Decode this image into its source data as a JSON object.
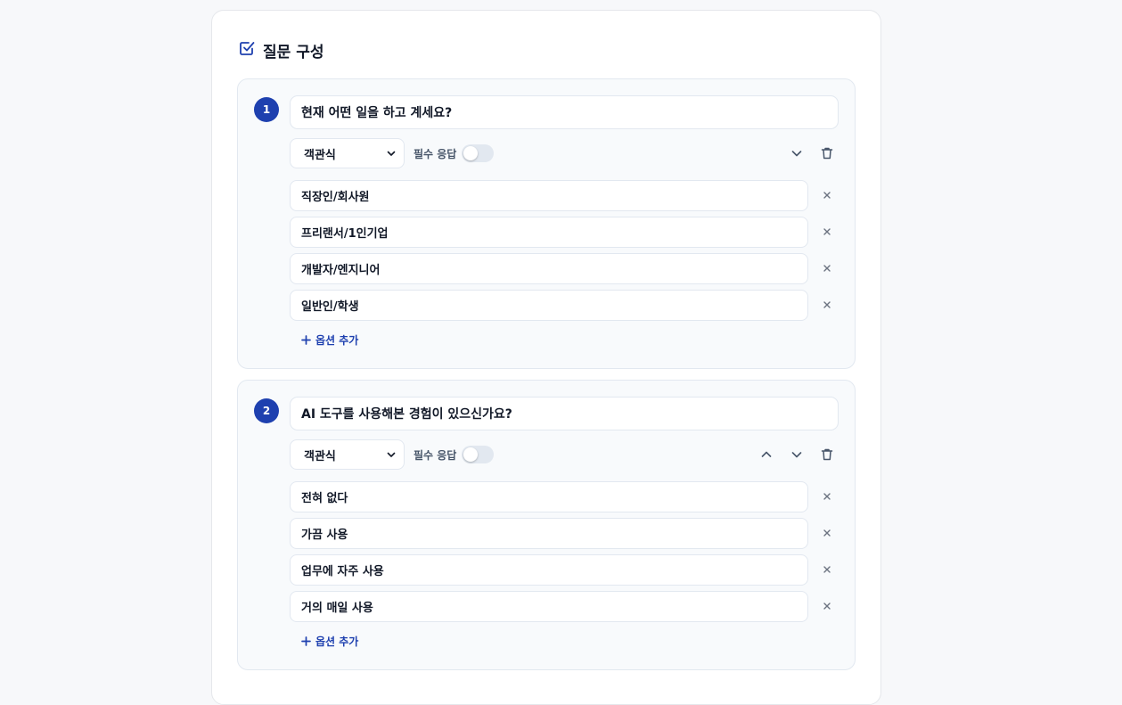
{
  "section": {
    "title": "질문 구성",
    "icon": "checkbox-icon"
  },
  "colors": {
    "accent": "#1e40af",
    "card_bg": "#f8fafc",
    "border": "#e2e8f0"
  },
  "questions": [
    {
      "number": "1",
      "title": "현재 어떤 일을 하고 계세요?",
      "type": "객관식",
      "required_label": "필수 응답",
      "required": false,
      "options": [
        "직장인/회사원",
        "프리랜서/1인기업",
        "개발자/엔지니어",
        "일반인/학생"
      ],
      "add_option_label": "옵션 추가"
    },
    {
      "number": "2",
      "title": "AI 도구를 사용해본 경험이 있으신가요?",
      "type": "객관식",
      "required_label": "필수 응답",
      "required": false,
      "options": [
        "전혀 없다",
        "가끔 사용",
        "업무에 자주 사용",
        "거의 매일 사용"
      ],
      "add_option_label": "옵션 추가"
    }
  ]
}
